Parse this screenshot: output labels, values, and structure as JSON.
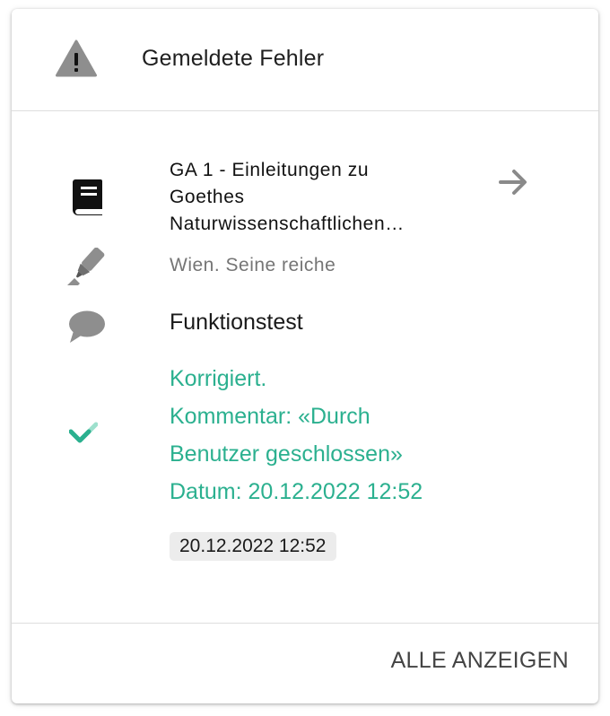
{
  "card": {
    "title": "Gemeldete Fehler",
    "header_icon": "warning-triangle-icon",
    "footer": {
      "show_all_label": "ALLE ANZEIGEN"
    }
  },
  "report": {
    "document_icon": "book-icon",
    "document_title_lines": [
      "GA 1 - Einleitungen zu",
      "Goethes",
      "Naturwissenschaftlichen…"
    ],
    "navigate_icon": "arrow-right-icon",
    "highlight_icon": "highlighter-marker-icon",
    "highlight_text": "Wien. Seine reiche",
    "comment_icon": "speech-bubble-icon",
    "test_name": "Funktionstest",
    "status_icon": "checkmark-icon",
    "status_lines": [
      "Korrigiert.",
      "Kommentar: «Durch",
      "Benutzer geschlossen»",
      "Datum: 20.12.2022 12:52"
    ],
    "date_chip": "20.12.2022 12:52"
  },
  "colors": {
    "status_green": "#2bb08f",
    "icon_grey": "#8e8e8e",
    "chip_background": "#ececec"
  }
}
